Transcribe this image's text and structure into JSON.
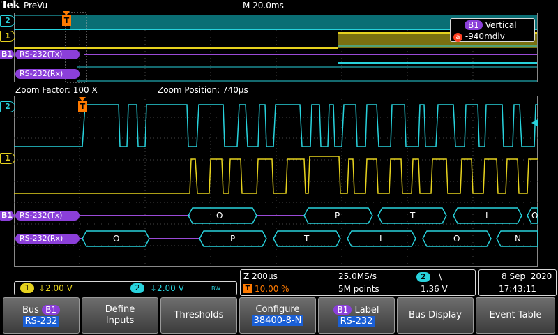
{
  "header": {
    "brand": "Tek",
    "mode": "PreVu",
    "timebase": "M 20.0ms"
  },
  "zoom": {
    "factor": "Zoom Factor: 100 X",
    "position": "Zoom Position: 740µs"
  },
  "channel_labels": {
    "ch2": "2",
    "ch1": "1",
    "bus": "B1"
  },
  "bus_labels": {
    "tx": "RS-232(Tx)",
    "rx": "RS-232(Rx)"
  },
  "tx_bytes": [
    "O",
    "P",
    "T",
    "I",
    "O"
  ],
  "rx_bytes": [
    "O",
    "P",
    "T",
    "I",
    "O",
    "N"
  ],
  "vertical_popup": {
    "badge": "B1",
    "title": "Vertical",
    "knob": "a",
    "value": "-940mdiv"
  },
  "trigger_marker": "T",
  "ch1_readout": {
    "num": "1",
    "value": "↓2.00 V"
  },
  "ch2_readout": {
    "num": "2",
    "value": "↓2.00 V",
    "bw": "BW"
  },
  "acq": {
    "zoom": "Z 200µs",
    "trig_label": "T",
    "trig_pos": "10.00 %",
    "rate": "25.0MS/s",
    "points": "5M points",
    "trig_ch": "2",
    "slope": "\\",
    "level": "1.36 V"
  },
  "datetime": {
    "date": "8 Sep  2020",
    "time": "17:43:11"
  },
  "softkeys": [
    {
      "line1": "Bus",
      "badge": "B1",
      "line2": "RS-232"
    },
    {
      "line1": "Define",
      "line2": "Inputs"
    },
    {
      "line1": "Thresholds"
    },
    {
      "line1": "Configure",
      "line2": "38400-8-N"
    },
    {
      "badge": "B1",
      "line1": "Label",
      "line2": "RS-232"
    },
    {
      "line1": "Bus Display"
    },
    {
      "line1": "Event Table"
    }
  ],
  "colors": {
    "ch1": "#e6d21e",
    "ch2": "#28d2dc",
    "bus": "#9a4ad6",
    "accent": "#ff7a00"
  }
}
